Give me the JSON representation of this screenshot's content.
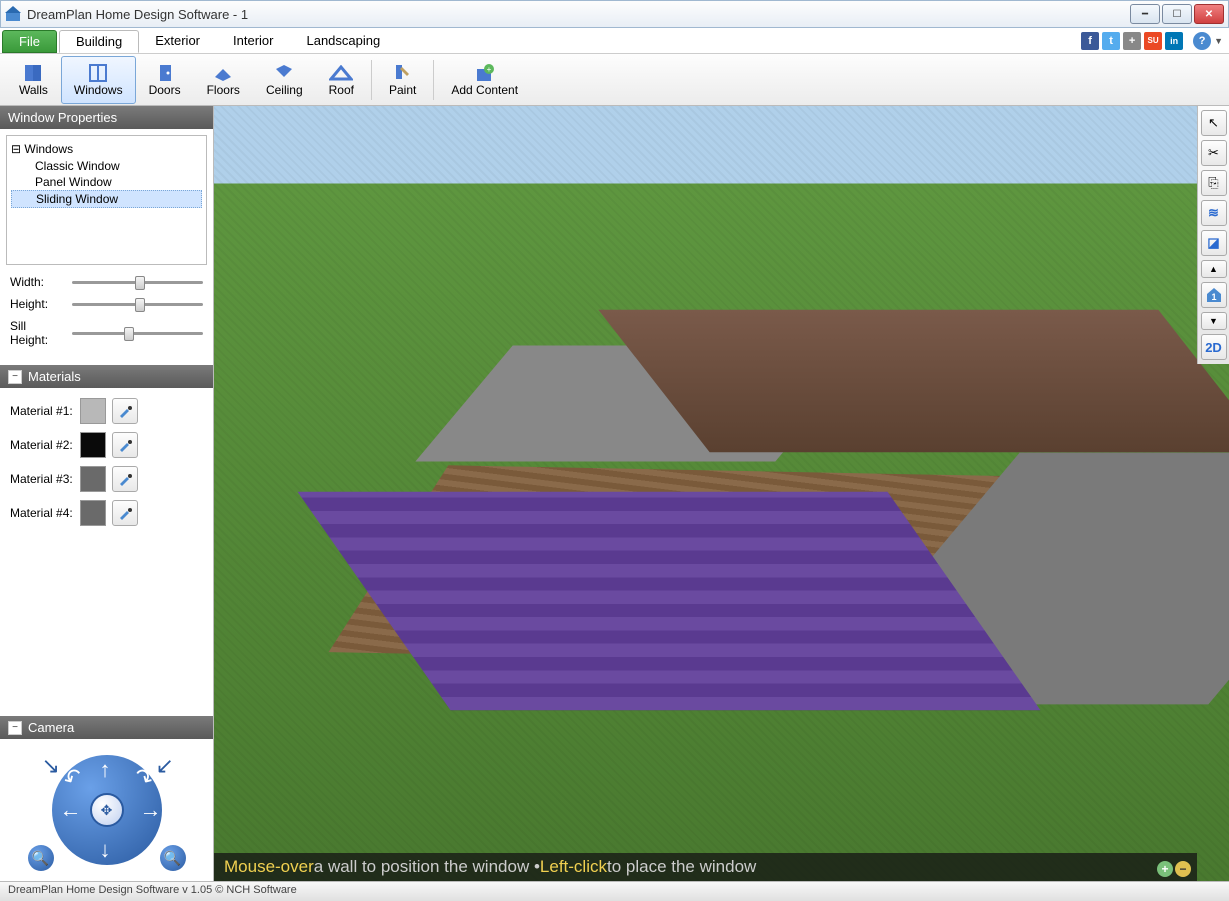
{
  "window": {
    "title": "DreamPlan Home Design Software - 1",
    "controls": {
      "min": "━",
      "max": "☐",
      "close": "✕"
    }
  },
  "menu": {
    "file": "File",
    "tabs": [
      "Building",
      "Exterior",
      "Interior",
      "Landscaping"
    ],
    "active": "Building"
  },
  "social": {
    "facebook": "f",
    "twitter": "t",
    "plus": "+",
    "stumble": "SU",
    "linkedin": "in",
    "help": "?"
  },
  "toolbar": {
    "items": [
      {
        "key": "walls",
        "label": "Walls"
      },
      {
        "key": "windows",
        "label": "Windows"
      },
      {
        "key": "doors",
        "label": "Doors"
      },
      {
        "key": "floors",
        "label": "Floors"
      },
      {
        "key": "ceiling",
        "label": "Ceiling"
      },
      {
        "key": "roof",
        "label": "Roof"
      },
      {
        "key": "paint",
        "label": "Paint"
      },
      {
        "key": "addcontent",
        "label": "Add Content"
      }
    ],
    "active": "windows"
  },
  "properties": {
    "title": "Window Properties",
    "tree_root": "Windows",
    "tree_items": [
      "Classic Window",
      "Panel Window",
      "Sliding Window"
    ],
    "tree_selected": "Sliding Window",
    "sliders": {
      "width": {
        "label": "Width:",
        "pos": 48
      },
      "height": {
        "label": "Height:",
        "pos": 48
      },
      "sill": {
        "label": "Sill Height:",
        "pos": 40
      }
    }
  },
  "materials": {
    "title": "Materials",
    "rows": [
      {
        "label": "Material #1:",
        "color": "#b8b8b8"
      },
      {
        "label": "Material #2:",
        "color": "#0a0a0a"
      },
      {
        "label": "Material #3:",
        "color": "#6a6a6a"
      },
      {
        "label": "Material #4:",
        "color": "#6a6a6a"
      }
    ]
  },
  "camera": {
    "title": "Camera"
  },
  "right_toolbar": {
    "cursor": "↖",
    "cut": "✂",
    "copy": "⎘",
    "layer": "≋",
    "box": "◪",
    "up": "▲",
    "floor1": "1",
    "down": "▼",
    "view2d": "2D"
  },
  "hint": {
    "seg1": "Mouse-over",
    "seg2": " a wall to position the window • ",
    "seg3": "Left-click",
    "seg4": " to place the window"
  },
  "status": "DreamPlan Home Design Software v 1.05 © NCH Software"
}
